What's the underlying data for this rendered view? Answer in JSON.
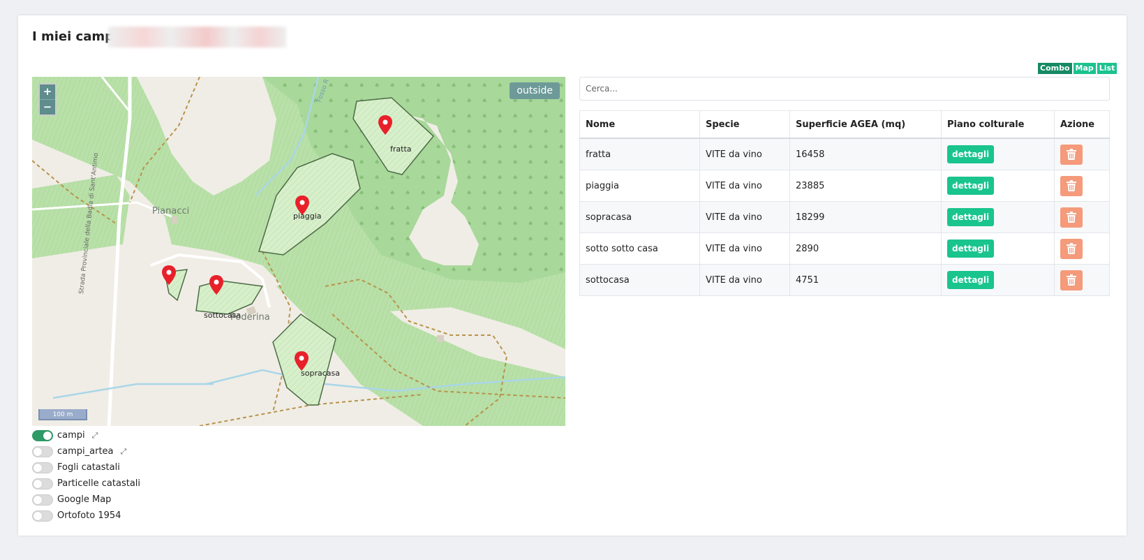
{
  "page": {
    "title": "I miei campi"
  },
  "view_switch": {
    "items": [
      "Combo",
      "Map",
      "List"
    ],
    "active": "Combo"
  },
  "map": {
    "outside_label": "outside",
    "zoom_in": "+",
    "zoom_out": "−",
    "scale_label": "100 m",
    "place_labels": [
      "Pianacci",
      "Poderina",
      "Strada Provinciale della Badia di Sant'Antimo",
      "Fosso R"
    ],
    "field_labels": [
      "fratta",
      "piaggia",
      "sottocasa",
      "sopracasa"
    ]
  },
  "layers": [
    {
      "label": "campi",
      "on": true,
      "expand": true
    },
    {
      "label": "campi_artea",
      "on": false,
      "expand": true
    },
    {
      "label": "Fogli catastali",
      "on": false,
      "expand": false
    },
    {
      "label": "Particelle catastali",
      "on": false,
      "expand": false
    },
    {
      "label": "Google Map",
      "on": false,
      "expand": false
    },
    {
      "label": "Ortofoto 1954",
      "on": false,
      "expand": false
    }
  ],
  "search": {
    "placeholder": "Cerca..."
  },
  "table": {
    "headers": [
      "Nome",
      "Specie",
      "Superficie AGEA (mq)",
      "Piano colturale",
      "Azione"
    ],
    "detail_label": "dettagli",
    "rows": [
      {
        "nome": "fratta",
        "specie": "VITE da vino",
        "superficie": "16458"
      },
      {
        "nome": "piaggia",
        "specie": "VITE da vino",
        "superficie": "23885"
      },
      {
        "nome": "sopracasa",
        "specie": "VITE da vino",
        "superficie": "18299"
      },
      {
        "nome": "sotto sotto casa",
        "specie": "VITE da vino",
        "superficie": "2890"
      },
      {
        "nome": "sottocasa",
        "specie": "VITE da vino",
        "superficie": "4751"
      }
    ]
  },
  "colors": {
    "accent": "#19c48d",
    "danger": "#f59a7a",
    "toggle_on": "#2e9a66"
  }
}
